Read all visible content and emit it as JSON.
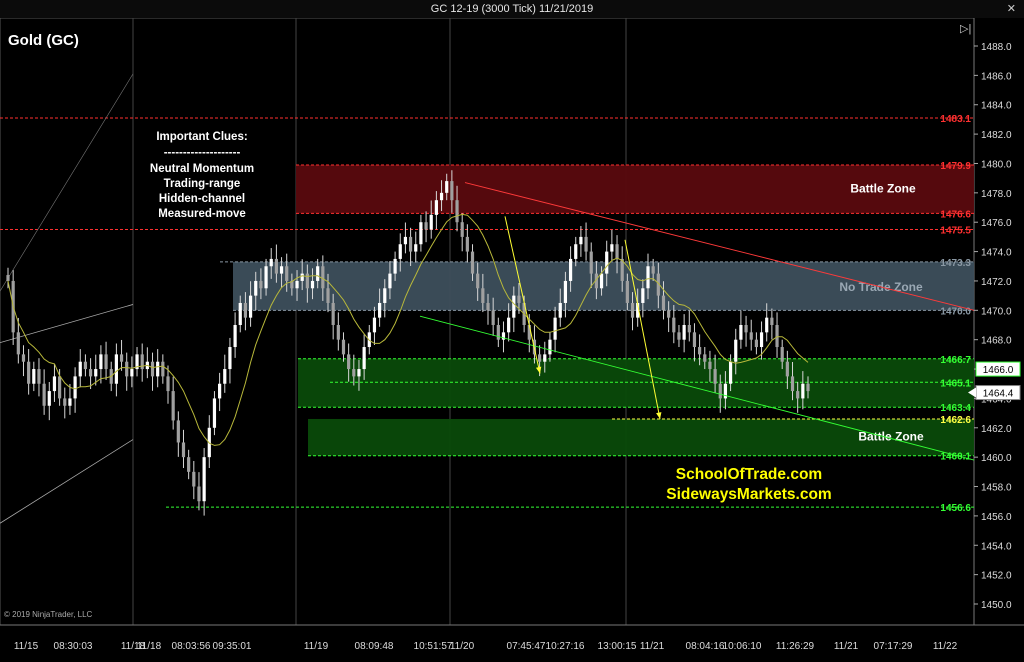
{
  "window": {
    "title": "GC 12-19 (3000 Tick)  11/21/2019",
    "close_glyph": "✕",
    "collapse_glyph": "▷|"
  },
  "instrument_label": "Gold (GC)",
  "copyright": "© 2019 NinjaTrader, LLC",
  "clues": {
    "title": "Important Clues:",
    "divider": "--------------------",
    "lines": [
      "Neutral Momentum",
      "Trading-range",
      "Hidden-channel",
      "Measured-move"
    ]
  },
  "watermark": {
    "line1": "SchoolOfTrade.com",
    "line2": "SidewaysMarkets.com",
    "color": "#ffff00"
  },
  "chart_data": {
    "type": "candlestick",
    "ylim": [
      1449,
      1489.5
    ],
    "yticks": [
      1450,
      1452,
      1454,
      1456,
      1458,
      1460,
      1462,
      1464,
      1466,
      1468,
      1470,
      1472,
      1474,
      1476,
      1478,
      1480,
      1482,
      1484,
      1486,
      1488
    ],
    "x_tick_labels": [
      "11/15",
      "08:30:03",
      "11/18",
      "11/18",
      "08:03:56",
      "09:35:01",
      "11/19",
      "08:09:48",
      "10:51:57",
      "11/20",
      "07:45:47",
      "10:27:16",
      "13:00:15",
      "11/21",
      "08:04:16",
      "10:06:10",
      "11:26:29",
      "11/21",
      "07:17:29",
      "11/22"
    ],
    "session_breaks": [
      "11/18",
      "11/19",
      "11/20",
      "11/21"
    ],
    "zones": [
      {
        "name": "Battle Zone",
        "top": 1479.9,
        "bottom": 1476.6,
        "color": "#5a0a0e"
      },
      {
        "name": "No Trade Zone",
        "top": 1473.3,
        "bottom": 1470.0,
        "color": "#3d4f5c"
      },
      {
        "name": "",
        "top": 1466.7,
        "bottom": 1463.4,
        "color": "#0a4a0a"
      },
      {
        "name": "Battle Zone",
        "top": 1462.6,
        "bottom": 1460.1,
        "color": "#0a4a0a"
      }
    ],
    "level_lines": [
      {
        "value": 1483.1,
        "label": "1483.1",
        "color": "#ff3030"
      },
      {
        "value": 1479.9,
        "label": "1479.9",
        "color": "#ff3030"
      },
      {
        "value": 1476.6,
        "label": "1476.6",
        "color": "#ff3030"
      },
      {
        "value": 1475.5,
        "label": "1475.5",
        "color": "#ff3030"
      },
      {
        "value": 1473.3,
        "label": "1473.3",
        "color": "#8a98a4"
      },
      {
        "value": 1470.0,
        "label": "1470.0",
        "color": "#8a98a4"
      },
      {
        "value": 1466.7,
        "label": "1466.7",
        "color": "#33ff33"
      },
      {
        "value": 1465.1,
        "label": "1465.1",
        "color": "#33ff33"
      },
      {
        "value": 1463.4,
        "label": "1463.4",
        "color": "#33ff33"
      },
      {
        "value": 1462.6,
        "label": "1462.6",
        "color": "#ffff44"
      },
      {
        "value": 1460.1,
        "label": "1460.1",
        "color": "#33ff33"
      },
      {
        "value": 1456.6,
        "label": "1456.6",
        "color": "#33ff33"
      }
    ],
    "last_price": {
      "value": 1466.0,
      "label": "1466.0"
    },
    "current_price": {
      "value": 1464.4,
      "label": "1464.4"
    },
    "closes": [
      1472,
      1468.5,
      1467,
      1466.5,
      1465,
      1466,
      1465,
      1463.5,
      1464.5,
      1465.5,
      1464,
      1463.5,
      1464,
      1465.5,
      1466.5,
      1466,
      1465.5,
      1466,
      1467,
      1466,
      1465,
      1467,
      1466.5,
      1465.5,
      1466,
      1467,
      1466,
      1466.5,
      1465.5,
      1466.5,
      1465.5,
      1464.5,
      1462.5,
      1461,
      1460,
      1459,
      1458,
      1457,
      1460,
      1462,
      1464,
      1465,
      1466,
      1467.5,
      1469,
      1470.5,
      1469.5,
      1471,
      1472,
      1471.5,
      1473,
      1473.5,
      1472.5,
      1473,
      1472,
      1471.5,
      1472,
      1472.5,
      1471.5,
      1472,
      1473,
      1471.5,
      1470.5,
      1469,
      1468,
      1467,
      1466,
      1465.5,
      1466,
      1467.5,
      1468.5,
      1469.5,
      1470.5,
      1471.5,
      1472.5,
      1473.5,
      1474.5,
      1475,
      1474,
      1474.5,
      1476,
      1475.5,
      1476.5,
      1477.5,
      1478,
      1478.8,
      1477.5,
      1476,
      1475,
      1474,
      1472.5,
      1471.5,
      1470.5,
      1470,
      1469,
      1468,
      1468.5,
      1469.5,
      1471,
      1470.5,
      1469,
      1468,
      1467,
      1466.5,
      1467,
      1468,
      1469.5,
      1470.5,
      1472,
      1473.5,
      1474.5,
      1475,
      1474,
      1472.5,
      1471.5,
      1472.5,
      1474,
      1474.5,
      1473.5,
      1472,
      1470.5,
      1469.5,
      1470.5,
      1471.5,
      1473,
      1472.5,
      1471,
      1470,
      1469.5,
      1468.5,
      1468,
      1469,
      1468.5,
      1467.5,
      1467,
      1466.5,
      1466,
      1465,
      1464,
      1465,
      1466.5,
      1468,
      1469,
      1468.5,
      1468,
      1467.5,
      1468.5,
      1469.5,
      1469,
      1467.5,
      1466.5,
      1465.5,
      1464.5,
      1464,
      1465,
      1464.5
    ]
  }
}
